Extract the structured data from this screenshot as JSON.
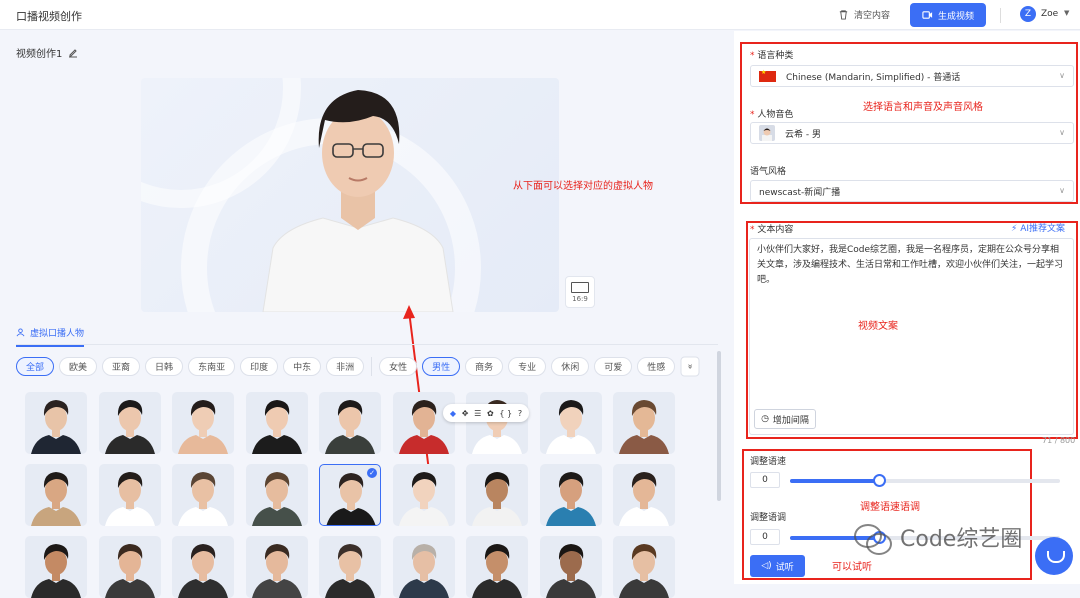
{
  "header": {
    "title": "口播视频创作",
    "clear_label": "清空内容",
    "generate_label": "生成视频",
    "user_initial": "Z",
    "user_name": "Zoe"
  },
  "left": {
    "project_name": "视频创作1",
    "ratio_label": "16:9",
    "section_tab": "虚拟口播人物",
    "region_filters": [
      "全部",
      "欧美",
      "亚裔",
      "日韩",
      "东南亚",
      "印度",
      "中东",
      "非洲"
    ],
    "other_filters": [
      "女性",
      "男性",
      "商务",
      "专业",
      "休闲",
      "可爱",
      "性感"
    ],
    "active_region": "全部",
    "active_other": "男性",
    "annotation_preview": "从下面可以选择对应的虚拟人物",
    "selected_avatar_index": 13,
    "avatars": [
      {
        "skin": "#e8c4a8",
        "hair": "#2a2220",
        "shirt": "#1f2633"
      },
      {
        "skin": "#ecc7ad",
        "hair": "#1c1a1a",
        "shirt": "#2a2a2a"
      },
      {
        "skin": "#efcdb5",
        "hair": "#241d1b",
        "shirt": "#e7b99a"
      },
      {
        "skin": "#efcbb2",
        "hair": "#1a1716",
        "shirt": "#1c1c1c"
      },
      {
        "skin": "#ecc6ab",
        "hair": "#1d1a19",
        "shirt": "#3a3f3b"
      },
      {
        "skin": "#e2b394",
        "hair": "#2b211c",
        "shirt": "#c72c2c"
      },
      {
        "skin": "#f0cdb5",
        "hair": "#3a2b22",
        "shirt": "#ffffff"
      },
      {
        "skin": "#f1d2bc",
        "hair": "#1c1a1a",
        "shirt": "#ffffff"
      },
      {
        "skin": "#e4b896",
        "hair": "#6a4a32",
        "shirt": "#8a5a45"
      },
      {
        "skin": "#d9a783",
        "hair": "#1f1b19",
        "shirt": "#c8a57e"
      },
      {
        "skin": "#e7bfa2",
        "hair": "#231d1a",
        "shirt": "#ffffff"
      },
      {
        "skin": "#e9c1a4",
        "hair": "#5a4535",
        "shirt": "#ffffff"
      },
      {
        "skin": "#e6bc9e",
        "hair": "#5b4431",
        "shirt": "#46504a"
      },
      {
        "skin": "#e9c3a7",
        "hair": "#2c2320",
        "shirt": "#1a1a1a"
      },
      {
        "skin": "#f1d3be",
        "hair": "#1e1b1a",
        "shirt": "#f4f4f4"
      },
      {
        "skin": "#b98560",
        "hair": "#1a1715",
        "shirt": "#f2f2f2"
      },
      {
        "skin": "#d6a07e",
        "hair": "#1d1a18",
        "shirt": "#2a7fb0"
      },
      {
        "skin": "#e4b797",
        "hair": "#2a211d",
        "shirt": "#ffffff"
      },
      {
        "skin": "#c48a64",
        "hair": "#1d1917",
        "shirt": "#2a2a2a"
      },
      {
        "skin": "#e4b596",
        "hair": "#3b2a20",
        "shirt": "#3a3a3a"
      },
      {
        "skin": "#e7bca0",
        "hair": "#2a2220",
        "shirt": "#2f2f2f"
      },
      {
        "skin": "#e5b99c",
        "hair": "#3a2b22",
        "shirt": "#444444"
      },
      {
        "skin": "#e8c1a5",
        "hair": "#3b2f2a",
        "shirt": "#2b2b2b"
      },
      {
        "skin": "#e6bfa5",
        "hair": "#b8b0a8",
        "shirt": "#2d3a4a"
      },
      {
        "skin": "#c58f6a",
        "hair": "#1b1816",
        "shirt": "#2b2b2b"
      },
      {
        "skin": "#9c6b4d",
        "hair": "#1a1614",
        "shirt": "#3a3a3a"
      },
      {
        "skin": "#e6bfa3",
        "hair": "#5a3a22",
        "shirt": "#3a3a3a"
      }
    ]
  },
  "right": {
    "language_label": "语言种类",
    "language_value": "Chinese (Mandarin, Simplified) - 普通话",
    "voice_label": "人物音色",
    "voice_value": "云希 - 男",
    "style_label": "语气风格",
    "style_value": "newscast-新闻广播",
    "annotation_settings": "选择语言和声音及声音风格",
    "text_label": "文本内容",
    "ai_label": "AI推荐文案",
    "text_content": "小伙伴们大家好，我是Code综艺圈，我是一名程序员，定期在公众号分享相关文章，涉及编程技术、生活日常和工作吐槽，欢迎小伙伴们关注，一起学习吧。",
    "annotation_text": "视频文案",
    "add_pause_label": "增加间隔",
    "char_count": "71 / 800",
    "speed_label": "调整语速",
    "speed_value": "0",
    "speed_fraction": 0.33,
    "pitch_label": "调整语调",
    "pitch_value": "0",
    "pitch_fraction": 0.33,
    "annotation_speed": "调整语速语调",
    "listen_label": "试听",
    "annotation_listen": "可以试听",
    "watermark_text": "Code综艺圈"
  },
  "colors": {
    "accent": "#3b6ef5",
    "annotation": "#e8241d"
  }
}
